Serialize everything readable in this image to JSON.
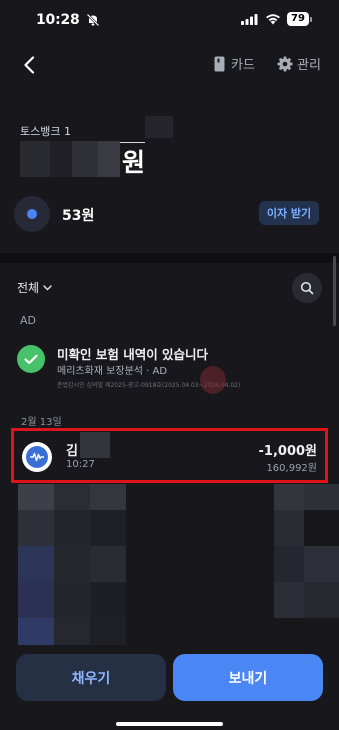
{
  "status_bar": {
    "time": "10:28",
    "battery": "79"
  },
  "top_nav": {
    "card_label": "카드",
    "manage_label": "관리"
  },
  "account": {
    "name": "토스뱅크 1",
    "balance_unit": "원"
  },
  "savings": {
    "amount": "53원",
    "interest_button": "이자 받기"
  },
  "filter": {
    "label": "전체"
  },
  "ad_section": {
    "label": "AD",
    "title": "미확인 보험 내역이 있습니다",
    "subtitle": "메리츠화재 보장분석 · AD",
    "fineprint": "준법감시인 심의필 제2025-광고-0918호(2025.04.03~2026.04.02)"
  },
  "transactions": {
    "date": "2월 13일",
    "items": [
      {
        "name": "김",
        "time": "10:27",
        "amount": "-1,000원",
        "balance": "160,992원"
      }
    ]
  },
  "bottom": {
    "charge_label": "채우기",
    "send_label": "보내기"
  },
  "colors": {
    "background": "#17171c",
    "accent": "#4a87f5",
    "highlight": "#e0121a",
    "success": "#45c26a"
  },
  "icons": [
    "bell-off-icon",
    "signal-icon",
    "wifi-icon",
    "back-arrow-icon",
    "card-icon",
    "gear-icon",
    "chevron-down-icon",
    "search-icon",
    "check-icon",
    "waveform-icon"
  ]
}
